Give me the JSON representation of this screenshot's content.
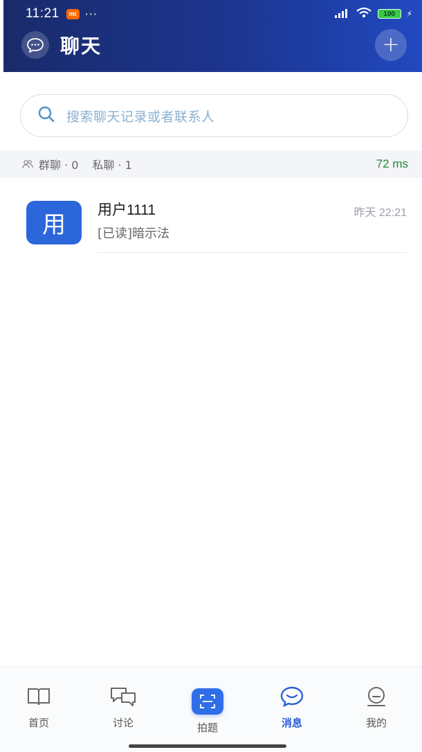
{
  "status_bar": {
    "time": "11:21",
    "carrier_badge": "mi",
    "dots": "···",
    "battery": "100"
  },
  "header": {
    "title": "聊天",
    "add_label": "+"
  },
  "search": {
    "placeholder": "搜索聊天记录或者联系人"
  },
  "counts": {
    "group_label": "群聊 · 0",
    "private_label": "私聊 · 1",
    "latency": "72 ms"
  },
  "conversations": [
    {
      "avatar_text": "用",
      "name": "用户1111",
      "time": "昨天 22:21",
      "preview": "[已读]暗示法"
    }
  ],
  "tabs": [
    {
      "label": "首页",
      "icon": "book-icon"
    },
    {
      "label": "讨论",
      "icon": "discussion-icon"
    },
    {
      "label": "拍题",
      "icon": "scan-icon"
    },
    {
      "label": "消息",
      "icon": "message-icon",
      "active": true
    },
    {
      "label": "我的",
      "icon": "profile-icon"
    }
  ],
  "colors": {
    "header_start": "#1a2b6b",
    "header_end": "#2149c0",
    "accent": "#2b66db",
    "active_tab": "#2b5fd6",
    "latency": "#1f8a2e"
  }
}
